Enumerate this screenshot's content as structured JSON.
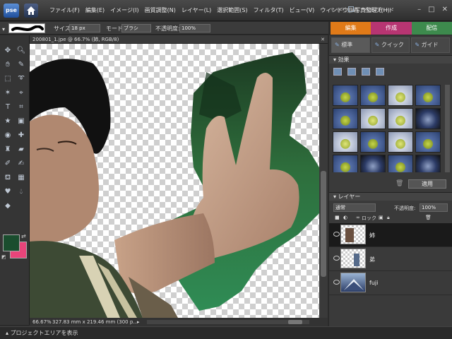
{
  "app": {
    "logo": "pse"
  },
  "menu": [
    "ファイル(F)",
    "編集(E)",
    "イメージ(I)",
    "画質調整(N)",
    "レイヤー(L)",
    "選択範囲(S)",
    "フィルタ(T)",
    "ビュー(V)",
    "ウィンドウ(W)",
    "ヘルプ(H)"
  ],
  "undo_label": "やり直し",
  "organizer_label": "写真整理モード",
  "window_controls": {
    "minimize": "–",
    "maximize": "□",
    "close": "✕"
  },
  "options": {
    "size_label": "サイズ:",
    "size_value": "18 px",
    "mode_label": "モード:",
    "mode_value": "ブラシ",
    "opacity_label": "不透明度:",
    "opacity_value": "100%"
  },
  "mode_tabs": {
    "edit": "編集",
    "create": "作成",
    "share": "配信"
  },
  "document": {
    "title": "200801_1.jpe @ 66.7% (姉, RGB/8)",
    "close": "✕",
    "zoom": "66.67%",
    "size_info": "327.83 mm x 219.46 mm (300 p..."
  },
  "right_tabs": [
    "標準",
    "クイック",
    "ガイド"
  ],
  "effects": {
    "header": "効果",
    "apply_label": "適用",
    "trash": "🗑"
  },
  "layers": {
    "header": "レイヤー",
    "blend_mode": "通常",
    "opacity_label": "不透明度:",
    "opacity_value": "100%",
    "lock_label": "ロック",
    "items": [
      {
        "name": "姉"
      },
      {
        "name": "弟"
      },
      {
        "name": "fuji"
      }
    ]
  },
  "project_area_label": "プロジェクトエリアを表示",
  "colors": {
    "foreground": "#1a4d2e",
    "background": "#e8447a",
    "tab_edit": "#e07a18",
    "tab_create": "#b73572",
    "tab_share": "#3d8a4d"
  }
}
